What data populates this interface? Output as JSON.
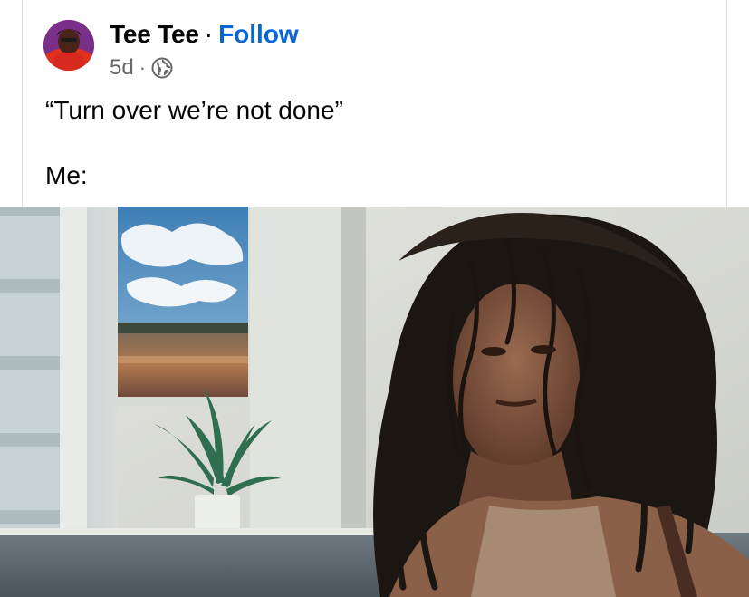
{
  "post": {
    "author": "Tee Tee",
    "separator": "·",
    "follow_label": "Follow",
    "age": "5d",
    "meta_separator": "·",
    "privacy_icon": "globe-icon",
    "text_line1": "“Turn over we’re not done”",
    "text_line2": "Me:"
  },
  "colors": {
    "follow": "#0866d9",
    "text": "#050505",
    "meta": "#65676b"
  }
}
